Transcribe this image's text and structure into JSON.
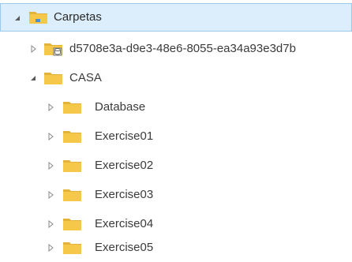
{
  "tree": {
    "root": {
      "label": "Carpetas",
      "expanded": true,
      "selected": true
    },
    "items": [
      {
        "label": "d5708e3a-d9e3-48e6-8055-ea34a93e3d7b",
        "expanded": false,
        "type": "database-folder"
      },
      {
        "label": "CASA",
        "expanded": true,
        "type": "folder"
      },
      {
        "label": "Database",
        "expanded": false,
        "type": "folder"
      },
      {
        "label": "Exercise01",
        "expanded": false,
        "type": "folder"
      },
      {
        "label": "Exercise02",
        "expanded": false,
        "type": "folder"
      },
      {
        "label": "Exercise03",
        "expanded": false,
        "type": "folder"
      },
      {
        "label": "Exercise04",
        "expanded": false,
        "type": "folder"
      },
      {
        "label": "Exercise05",
        "expanded": false,
        "type": "folder"
      }
    ]
  },
  "colors": {
    "selection_bg": "#dceefb",
    "selection_border": "#99c9ef",
    "folder": "#f5c84a",
    "folder_dark": "#e3b23a",
    "chevron": "#8a8a8a"
  },
  "icons": {
    "expanded": "chevron-down-icon",
    "collapsed": "chevron-right-icon",
    "folder": "folder-icon",
    "database_folder": "database-folder-icon"
  }
}
